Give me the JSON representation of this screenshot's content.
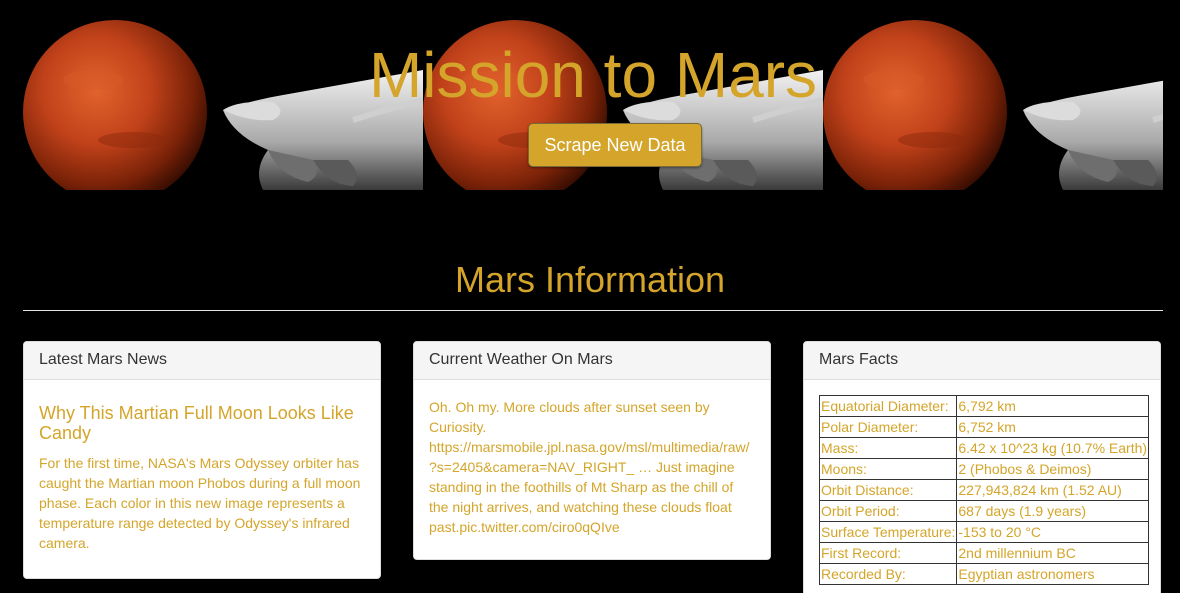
{
  "hero": {
    "title": "Mission to Mars",
    "scrape_button": "Scrape New Data"
  },
  "section": {
    "title": "Mars Information"
  },
  "news": {
    "heading": "Latest Mars News",
    "title": "Why This Martian Full Moon Looks Like Candy",
    "body": "For the first time, NASA's Mars Odyssey orbiter has caught the Martian moon Phobos during a full moon phase. Each color in this new image represents a temperature range detected by Odyssey's infrared camera."
  },
  "weather": {
    "heading": "Current Weather On Mars",
    "text": "Oh. Oh my. More clouds after sunset seen by Curiosity. https://marsmobile.jpl.nasa.gov/msl/multimedia/raw/?s=2405&camera=NAV_RIGHT_ … Just imagine standing in the foothills of Mt Sharp as the chill of the night arrives, and watching these clouds float past.pic.twitter.com/ciro0qQIve"
  },
  "facts": {
    "heading": "Mars Facts",
    "rows": [
      {
        "label": "Equatorial Diameter:",
        "value": "6,792 km"
      },
      {
        "label": "Polar Diameter:",
        "value": "6,752 km"
      },
      {
        "label": "Mass:",
        "value": "6.42 x 10^23 kg (10.7% Earth)"
      },
      {
        "label": "Moons:",
        "value": "2 (Phobos & Deimos)"
      },
      {
        "label": "Orbit Distance:",
        "value": "227,943,824 km (1.52 AU)"
      },
      {
        "label": "Orbit Period:",
        "value": "687 days (1.9 years)"
      },
      {
        "label": "Surface Temperature:",
        "value": "-153 to 20 °C"
      },
      {
        "label": "First Record:",
        "value": "2nd millennium BC"
      },
      {
        "label": "Recorded By:",
        "value": "Egyptian astronomers"
      }
    ]
  },
  "colors": {
    "accent": "#d4a52a",
    "background": "#000000",
    "panel": "#ffffff",
    "panel_heading": "#f5f5f5"
  },
  "icons": {
    "hero_tile": "mars-planet-with-astronaut-glove-image"
  }
}
